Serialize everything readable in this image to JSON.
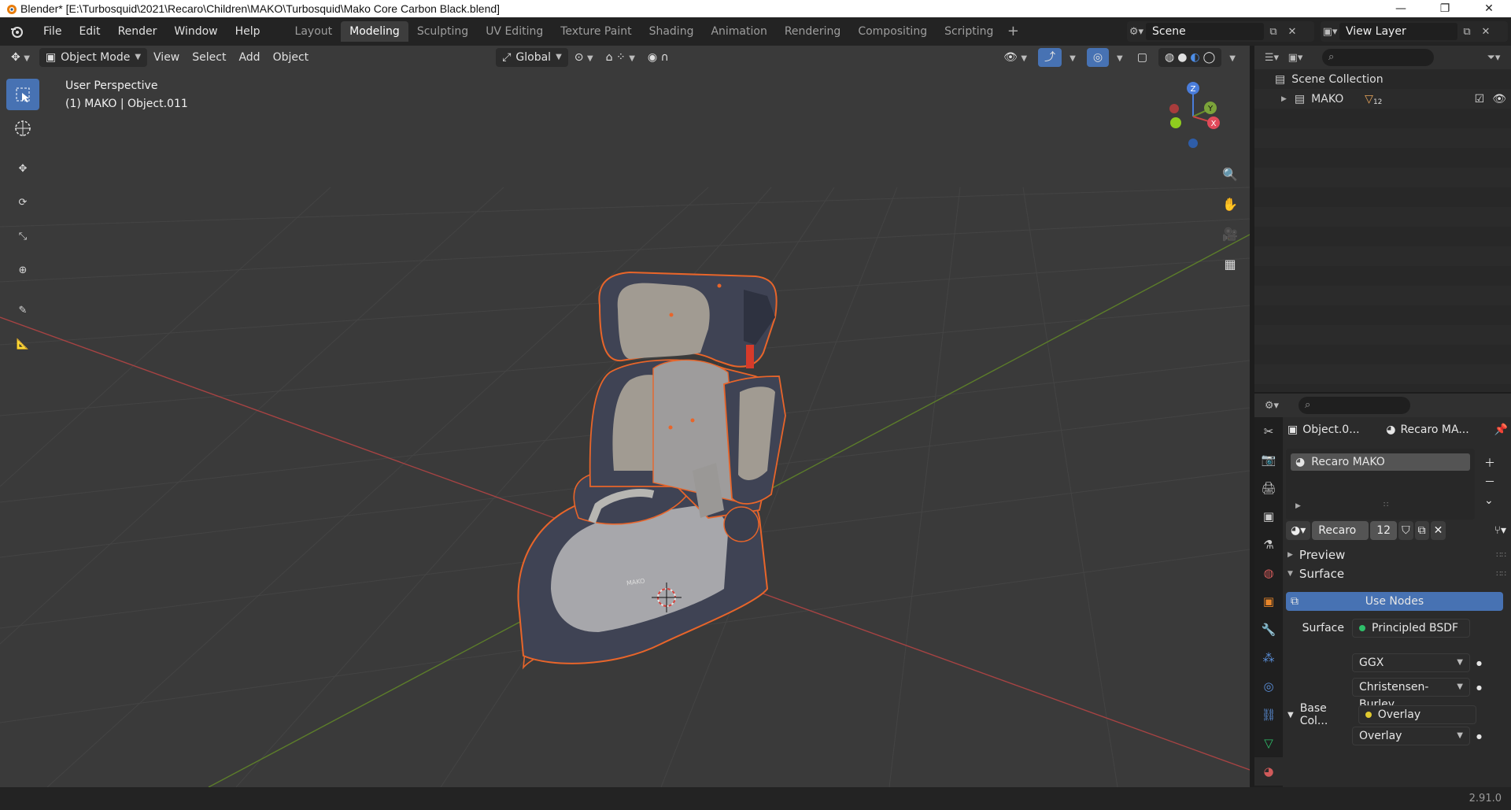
{
  "window": {
    "title": "Blender* [E:\\Turbosquid\\2021\\Recaro\\Children\\MAKO\\Turbosquid\\Mako Core Carbon Black.blend]"
  },
  "menu": {
    "items": [
      "File",
      "Edit",
      "Render",
      "Window",
      "Help"
    ]
  },
  "workspaces": {
    "tabs": [
      "Layout",
      "Modeling",
      "Sculpting",
      "UV Editing",
      "Texture Paint",
      "Shading",
      "Animation",
      "Rendering",
      "Compositing",
      "Scripting"
    ],
    "active": "Modeling"
  },
  "scene": {
    "name": "Scene"
  },
  "view_layer": {
    "name": "View Layer"
  },
  "viewport": {
    "mode": "Object Mode",
    "menus": [
      "View",
      "Select",
      "Add",
      "Object"
    ],
    "orientation": "Global",
    "info_line1": "User Perspective",
    "info_line2": "(1) MAKO | Object.011",
    "gizmo": {
      "z": "Z",
      "y": "Y",
      "x": "X"
    },
    "seat_label": "MAKO"
  },
  "outliner": {
    "root": "Scene Collection",
    "collection": "MAKO",
    "count": "12"
  },
  "properties": {
    "object_crumb": "Object.0...",
    "material_crumb": "Recaro MA...",
    "slot_name": "Recaro MAKO",
    "material_field": "Recaro ...",
    "users": "12",
    "panel_preview": "Preview",
    "panel_surface": "Surface",
    "use_nodes": "Use Nodes",
    "surface_label": "Surface",
    "surface_value": "Principled BSDF",
    "distribution": "GGX",
    "subsurface": "Christensen-Burley",
    "base_color_label": "Base Col...",
    "base_color_value": "Overlay",
    "overlay2": "Overlay"
  },
  "status": {
    "version": "2.91.0"
  },
  "colors": {
    "accent": "#4772b3",
    "selection_outline": "#e8652a",
    "x_axis": "#c94545",
    "y_axis": "#6a8f2a",
    "z_axis": "#4a7ddb"
  }
}
